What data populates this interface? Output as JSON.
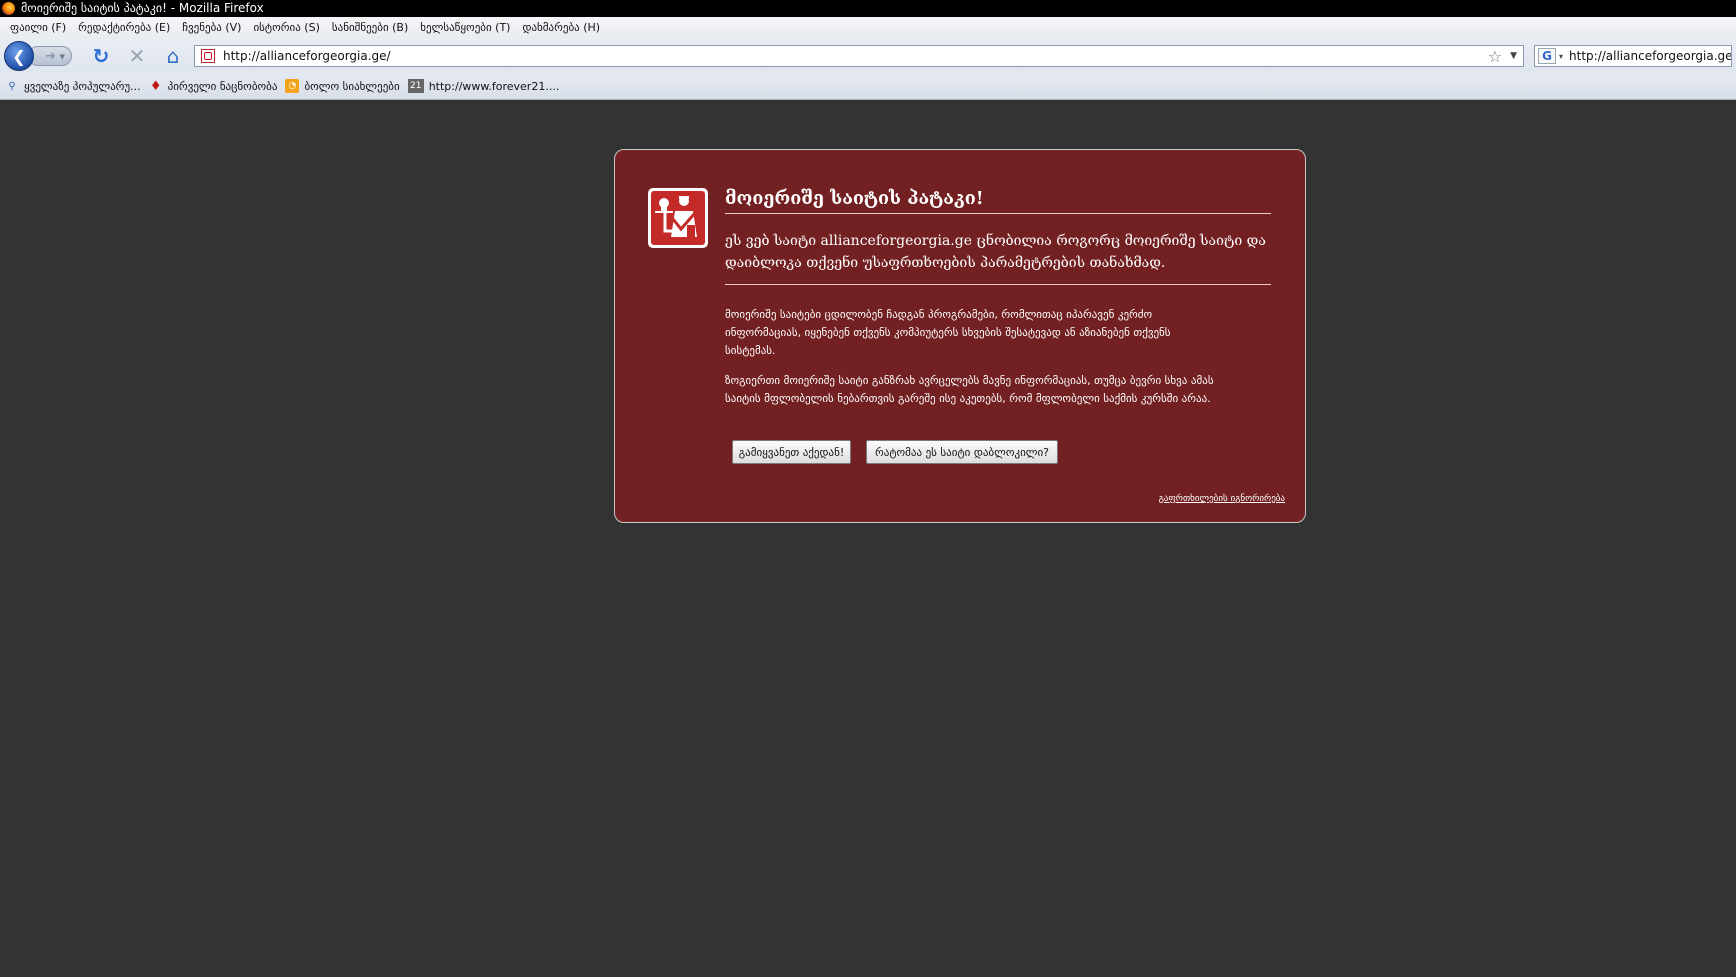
{
  "window": {
    "title": "მოიერიშე საიტის პატაკი! - Mozilla Firefox"
  },
  "menubar": {
    "items": [
      "ფაილი (F)",
      "რედაქტირება (E)",
      "ჩვენება (V)",
      "ისტორია (S)",
      "სანიშნეები (B)",
      "ხელსაწყოები (T)",
      "დახმარება (H)"
    ]
  },
  "navbar": {
    "url": "http://allianceforgeorgia.ge/",
    "search_value": "http://allianceforgeorgia.ge/",
    "search_engine_icon": "G"
  },
  "bookmarks": {
    "items": [
      {
        "label": "ყველაზე პოპულარუ...",
        "icon": "search-icon"
      },
      {
        "label": "პირველი ნაცნობობა",
        "icon": "red-bird-icon"
      },
      {
        "label": "ბოლო სიახლეები",
        "icon": "rss-icon"
      },
      {
        "label": "http://www.forever21....",
        "icon": "21-icon",
        "icon_text": "21"
      }
    ]
  },
  "error_panel": {
    "title": "მოიერიშე საიტის პატაკი!",
    "description": "ეს ვებ საიტი allianceforgeorgia.ge ცნობილია როგორც მოიერიშე საიტი და დაიბლოკა თქვენი უსაფრთხოების პარამეტრების თანახმად.",
    "paragraph1": "მოიერიშე საიტები ცდილობენ ჩადგან პროგრამები, რომლითაც იპარავენ კერძო ინფორმაციას, იყენებენ თქვენს კომპიუტერს სხვების შესატევად ან აზიანებენ თქვენს სისტემას.",
    "paragraph2": "ზოგიერთი მოიერიშე საიტი განზრახ ავრცელებს მავნე ინფორმაციას, თუმცა ბევრი სხვა ამას საიტის მფლობელის ნებართვის გარეშე ისე აკეთებს, რომ მფლობელი საქმის კურსში არაა.",
    "leave_button": "გამიყვანეთ აქედან!",
    "why_button": "რატომაა ეს საიტი დაბლოკილი?",
    "advanced_link": "გაფრთხილების იგნორირება"
  },
  "colors": {
    "page_background": "#333333",
    "panel_background": "#722021",
    "icon_red": "#c42a27"
  }
}
